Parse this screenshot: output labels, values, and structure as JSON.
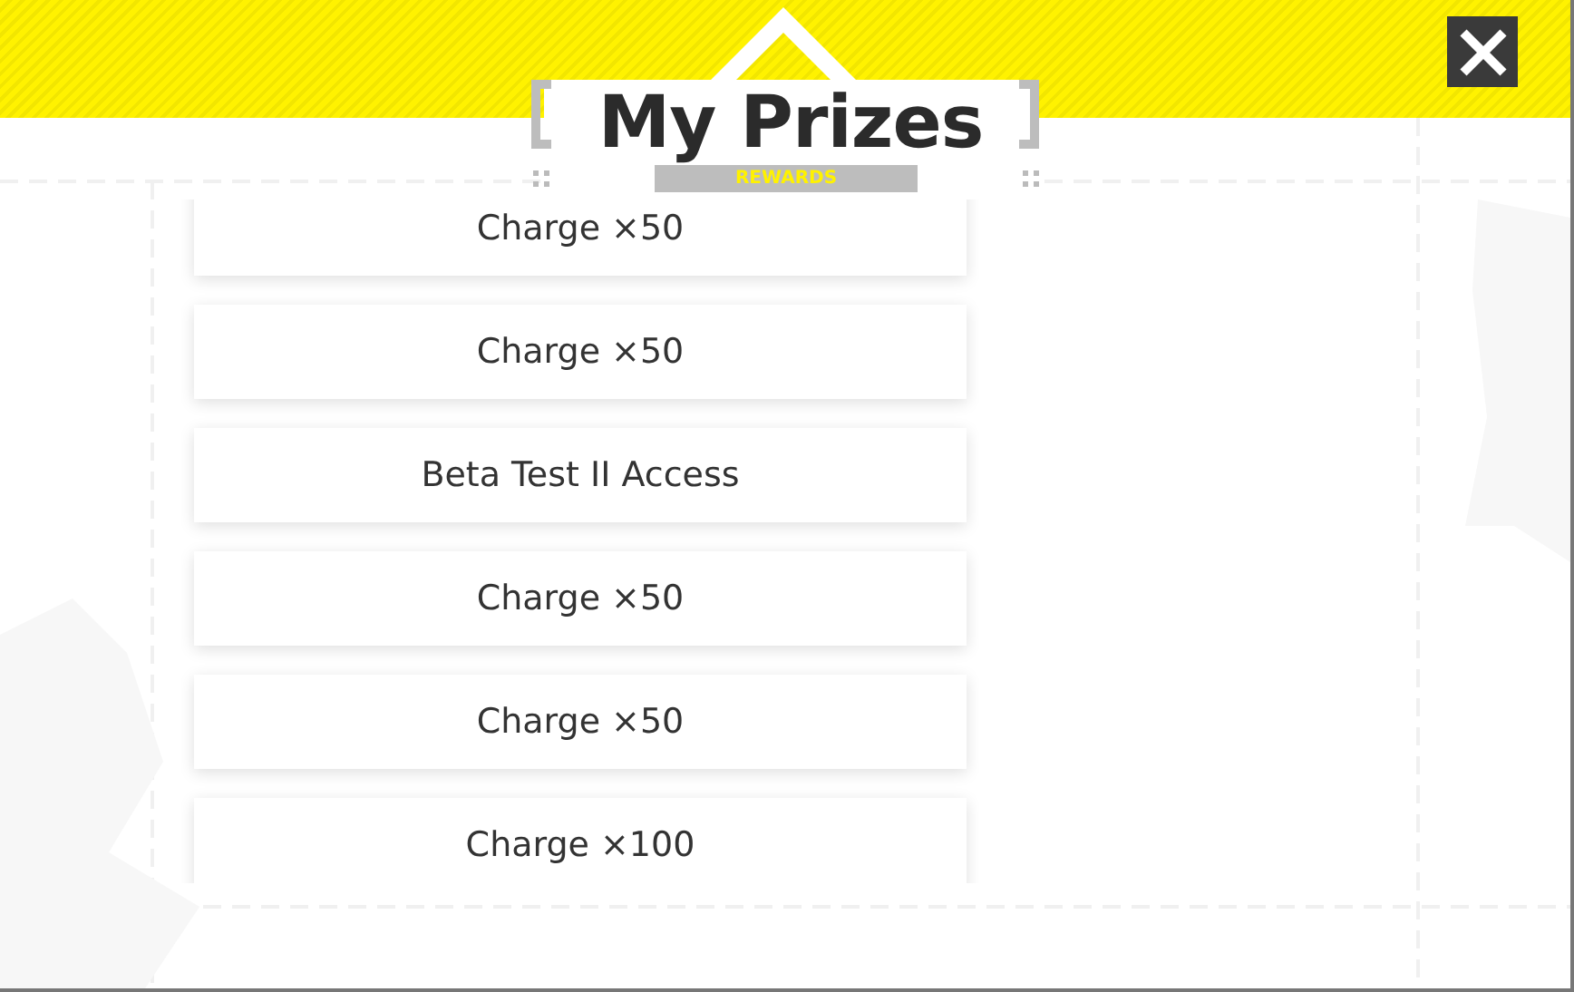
{
  "header": {
    "title": "My Prizes",
    "subtitle": "REWARDS"
  },
  "prizes": [
    {
      "label": "Charge ×50"
    },
    {
      "label": "Charge ×50"
    },
    {
      "label": "Beta Test II Access"
    },
    {
      "label": "Charge ×50"
    },
    {
      "label": "Charge ×50"
    },
    {
      "label": "Charge ×100"
    }
  ]
}
